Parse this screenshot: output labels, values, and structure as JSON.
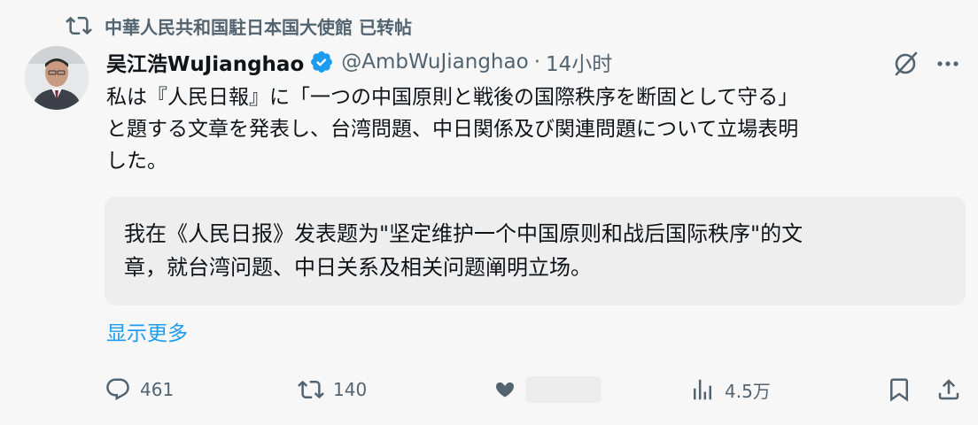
{
  "retweeter": {
    "text": "中華人民共和国駐日本国大使館 已转帖"
  },
  "author": {
    "name": "吴江浩WuJianghao",
    "handle": "@AmbWuJianghao",
    "separator": "·",
    "time": "14小时"
  },
  "tweet": {
    "text": "私は『人民日報』に「一つの中国原則と戦後の国際秩序を断固として守る」\nと題する文章を発表し、台湾問題、中日関係及び関連問題について立場表明\nした。"
  },
  "translation": {
    "text": "我在《人民日报》发表题为\"坚定维护一个中国原则和战后国际秩序\"的文\n章，就台湾问题、中日关系及相关问题阐明立场。"
  },
  "show_more": "显示更多",
  "actions": {
    "replies": "461",
    "retweets": "140",
    "views": "4.5万"
  },
  "colors": {
    "accent": "#1d9bf0",
    "muted": "#536471",
    "text": "#0f1419",
    "background": "#f7f7f7"
  },
  "icons": [
    "retweet-icon",
    "verified-badge-icon",
    "grok-icon",
    "more-icon",
    "reply-icon",
    "like-icon",
    "views-icon",
    "bookmark-icon",
    "share-icon"
  ]
}
